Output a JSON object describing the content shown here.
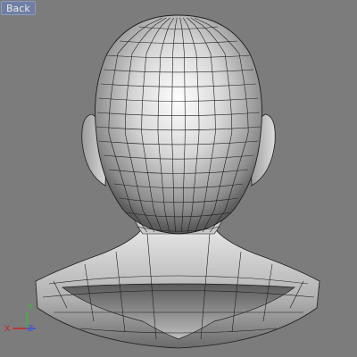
{
  "viewport": {
    "view_label": "Back",
    "background_color": "#7c7c7c"
  },
  "model": {
    "description_icon": "head-mesh",
    "wire_color": "#1e1e1e"
  },
  "axis_gizmo": {
    "x_label": "X",
    "y_label": "Y",
    "z_label": "Z",
    "x_color": "#d02020",
    "y_color": "#30c030",
    "z_color": "#3050e0"
  }
}
